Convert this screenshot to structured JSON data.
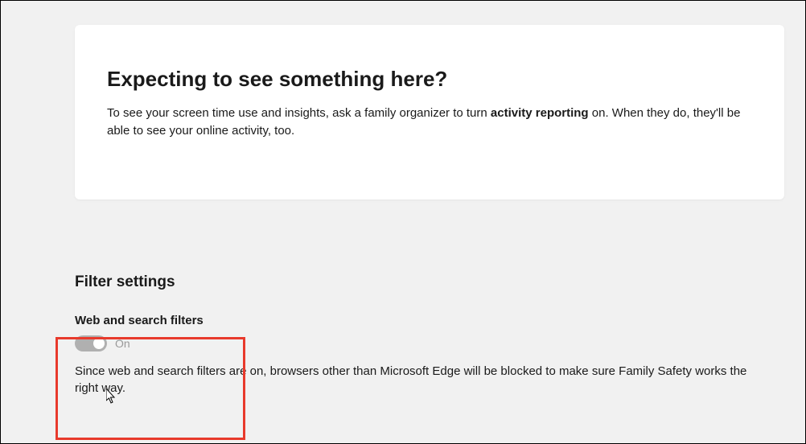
{
  "card": {
    "title": "Expecting to see something here?",
    "desc_before": "To see your screen time use and insights, ask a family organizer to turn ",
    "desc_bold": "activity reporting",
    "desc_after": " on. When they do, they'll be able to see your online activity, too."
  },
  "filter": {
    "section_title": "Filter settings",
    "subsection_title": "Web and search filters",
    "toggle_state": "On",
    "subsection_desc": "Since web and search filters are on, browsers other than Microsoft Edge will be blocked to make sure Family Safety works the right way."
  }
}
